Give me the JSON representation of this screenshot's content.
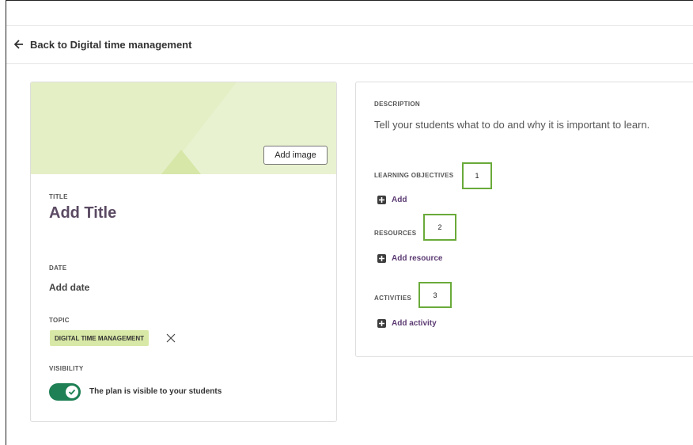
{
  "header": {
    "back_label": "Back to Digital time management"
  },
  "plan_card": {
    "add_image_label": "Add image",
    "title_label": "TITLE",
    "title_value": "Add Title",
    "date_label": "DATE",
    "date_value": "Add date",
    "topic_label": "TOPIC",
    "topic_chip": "DIGITAL TIME MANAGEMENT",
    "visibility_label": "VISIBILITY",
    "visibility_on": true,
    "visibility_text": "The plan is visible to your students"
  },
  "details_card": {
    "description_label": "DESCRIPTION",
    "description_placeholder": "Tell your students what to do and why it is important to learn.",
    "objectives_label": "LEARNING OBJECTIVES",
    "objectives_add": "Add",
    "resources_label": "RESOURCES",
    "resources_add": "Add resource",
    "activities_label": "ACTIVITIES",
    "activities_add": "Add activity"
  },
  "annotations": [
    "1",
    "2",
    "3"
  ],
  "colors": {
    "banner": "#e4efc6",
    "chip": "#d8e8a6",
    "toggle_on": "#1e8054",
    "title_text": "#5b4a63",
    "link_text": "#5b3a72",
    "annotation_border": "#6aaa3a"
  }
}
